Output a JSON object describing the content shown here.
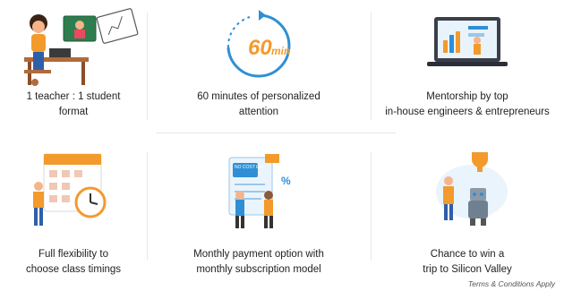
{
  "features": [
    {
      "label_line1": "1 teacher : 1 student",
      "label_line2": "format",
      "icon": "teacher-student-icon"
    },
    {
      "label_line1": "60 minutes of personalized",
      "label_line2": "attention",
      "icon": "sixty-min-timer-icon",
      "badge": "60",
      "badge_unit": "min"
    },
    {
      "label_line1": "Mentorship by top",
      "label_line2": "in-house engineers & entrepreneurs",
      "icon": "mentorship-icon"
    },
    {
      "label_line1": "Full flexibility to",
      "label_line2": "choose class timings",
      "icon": "calendar-clock-icon"
    },
    {
      "label_line1": "Monthly payment option with",
      "label_line2": "monthly subscription model",
      "icon": "emi-payment-icon",
      "badge": "NO COST EMI",
      "badge2": "%"
    },
    {
      "label_line1": "Chance to win a",
      "label_line2": "trip to Silicon Valley",
      "icon": "trophy-robot-icon"
    }
  ],
  "footer": {
    "terms": "Terms & Conditions Apply"
  },
  "colors": {
    "accent": "#f39a2c",
    "blue": "#2f8fd6",
    "skin": "#f5b48a"
  }
}
